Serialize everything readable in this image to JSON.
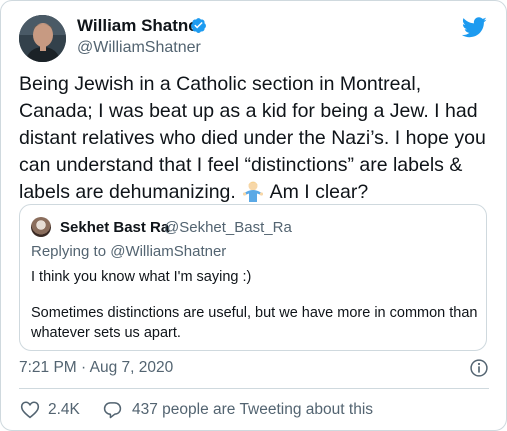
{
  "author": {
    "name": "William Shatner",
    "handle": "@WilliamShatner"
  },
  "tweet": {
    "text_before_emoji": "Being Jewish in a Catholic section in Montreal, Canada; I was beat up as a kid for being a Jew. I had distant relatives who died under the Nazi’s. I hope you can understand that I feel “distinctions” are labels & labels are dehumanizing.",
    "text_after_emoji": "Am I clear?",
    "emoji": "man-shrugging-emoji"
  },
  "quoted": {
    "name": "Sekhet Bast Ra",
    "handle": "@Sekhet_Bast_Ra",
    "replying_to": "Replying to @WilliamShatner",
    "line1": "I think you know what I'm saying :)",
    "line2": "Sometimes distinctions are useful, but we have more in common than whatever sets us apart."
  },
  "meta": {
    "timestamp": "7:21 PM · Aug 7, 2020",
    "likes": "2.4K",
    "tweeting_about": "437 people are Tweeting about this"
  },
  "colors": {
    "twitter_blue": "#1d9bf0",
    "text": "#0f1419",
    "muted": "#536471",
    "border": "#cfd9de"
  },
  "icons": [
    "twitter-bird-icon",
    "verified-badge-icon",
    "info-icon",
    "heart-icon",
    "reply-bubble-icon"
  ]
}
